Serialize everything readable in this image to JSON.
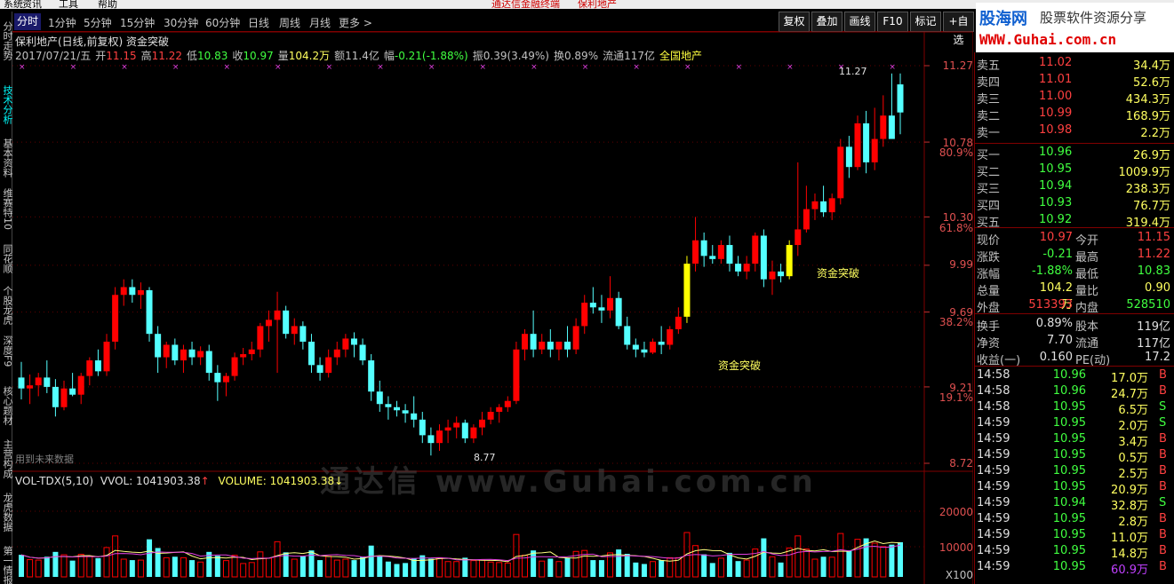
{
  "menu": {
    "items": [
      "系统",
      "资讯",
      "工具",
      "帮助"
    ],
    "title": "通达信金融终端",
    "stock": "保利地产"
  },
  "left_tabs": [
    "分时走势",
    "技术分析",
    "基本资料",
    "维赛特10",
    "同花顺",
    "个股龙虎",
    "深度F9",
    "核心题材",
    "主营构成",
    "龙虎数据",
    "第一情报"
  ],
  "periods": [
    "分时",
    "1分钟",
    "5分钟",
    "15分钟",
    "30分钟",
    "60分钟",
    "日线",
    "周线",
    "月线",
    "更多 >"
  ],
  "toolbar_buttons": [
    "复权",
    "叠加",
    "画线",
    "F10",
    "标记",
    "+自选"
  ],
  "brand": {
    "name": "股海网",
    "slogan": "股票软件资源分享",
    "url": "WWW.Guhai.com.cn"
  },
  "chart_header": "保利地产(日线,前复权) 资金突破",
  "info": {
    "date": "2017/07/21/五",
    "open_label": "开",
    "open": "11.15",
    "high_label": "高",
    "high": "11.22",
    "low_label": "低",
    "low": "10.83",
    "close_label": "收",
    "close": "10.97",
    "vol_label": "量",
    "vol": "104.2万",
    "amt_label": "额",
    "amt": "11.4亿",
    "chg_label": "幅",
    "chg": "-0.21(-1.88%)",
    "amp_label": "振",
    "amp": "0.39(3.49%)",
    "turn_label": "换",
    "turn": "0.89%",
    "float_label": "流通",
    "float": "117亿",
    "sector": "全国地产"
  },
  "price_axis": [
    "11.27",
    "10.78",
    "10.30",
    "9.99",
    "9.69",
    "9.21",
    "8.72"
  ],
  "pct_axis": [
    "80.9%",
    "61.8%",
    "38.2%",
    "19.1%"
  ],
  "vol_axis": [
    "20000",
    "10000",
    "X100"
  ],
  "annotations": {
    "high": "11.27",
    "low": "8.77",
    "signal1": "资金突破",
    "signal2": "资金突破",
    "future": "用到未来数据"
  },
  "vol_indicator": {
    "name": "VOL-TDX(5,10)",
    "vvol": "VVOL: 1041903.38",
    "volume": "VOLUME: 1041903.38"
  },
  "colors": {
    "up": "#ff0000",
    "down": "#54ffff",
    "signal": "#ffff00",
    "accent": "#ff3030"
  },
  "order_book": {
    "sell": [
      {
        "label": "卖五",
        "price": "11.02",
        "vol": "34.4万"
      },
      {
        "label": "卖四",
        "price": "11.01",
        "vol": "52.6万"
      },
      {
        "label": "卖三",
        "price": "11.00",
        "vol": "434.3万"
      },
      {
        "label": "卖二",
        "price": "10.99",
        "vol": "168.9万"
      },
      {
        "label": "卖一",
        "price": "10.98",
        "vol": "2.2万"
      }
    ],
    "buy": [
      {
        "label": "买一",
        "price": "10.96",
        "vol": "26.9万"
      },
      {
        "label": "买二",
        "price": "10.95",
        "vol": "1009.9万"
      },
      {
        "label": "买三",
        "price": "10.94",
        "vol": "238.3万"
      },
      {
        "label": "买四",
        "price": "10.93",
        "vol": "76.7万"
      },
      {
        "label": "买五",
        "price": "10.92",
        "vol": "319.4万"
      }
    ]
  },
  "quote": [
    {
      "l1": "现价",
      "v1": "10.97",
      "l2": "今开",
      "v2": "11.15"
    },
    {
      "l1": "涨跌",
      "v1": "-0.21",
      "l2": "最高",
      "v2": "11.22"
    },
    {
      "l1": "涨幅",
      "v1": "-1.88%",
      "l2": "最低",
      "v2": "10.83"
    },
    {
      "l1": "总量",
      "v1": "104.2万",
      "l2": "量比",
      "v2": "0.90"
    },
    {
      "l1": "外盘",
      "v1": "513393",
      "l2": "内盘",
      "v2": "528510"
    }
  ],
  "stats": [
    {
      "l1": "换手",
      "v1": "0.89%",
      "l2": "股本",
      "v2": "119亿"
    },
    {
      "l1": "净资",
      "v1": "7.70",
      "l2": "流通",
      "v2": "117亿"
    },
    {
      "l1": "收益(一)",
      "v1": "0.160",
      "l2": "PE(动)",
      "v2": "17.2"
    }
  ],
  "ticks": [
    {
      "t": "14:58",
      "p": "10.96",
      "v": "17.0万",
      "s": "B"
    },
    {
      "t": "14:58",
      "p": "10.96",
      "v": "24.7万",
      "s": "B"
    },
    {
      "t": "14:58",
      "p": "10.95",
      "v": "6.5万",
      "s": "S"
    },
    {
      "t": "14:59",
      "p": "10.95",
      "v": "2.0万",
      "s": "S"
    },
    {
      "t": "14:59",
      "p": "10.95",
      "v": "3.4万",
      "s": "B"
    },
    {
      "t": "14:59",
      "p": "10.95",
      "v": "0.5万",
      "s": "B"
    },
    {
      "t": "14:59",
      "p": "10.95",
      "v": "2.5万",
      "s": "B"
    },
    {
      "t": "14:59",
      "p": "10.95",
      "v": "20.9万",
      "s": "B"
    },
    {
      "t": "14:59",
      "p": "10.94",
      "v": "32.8万",
      "s": "S"
    },
    {
      "t": "14:59",
      "p": "10.95",
      "v": "2.8万",
      "s": "B"
    },
    {
      "t": "14:59",
      "p": "10.95",
      "v": "11.0万",
      "s": "B"
    },
    {
      "t": "14:59",
      "p": "10.95",
      "v": "14.8万",
      "s": "B"
    },
    {
      "t": "14:59",
      "p": "10.95",
      "v": "60.9万",
      "s": "B"
    }
  ],
  "chart_data": {
    "type": "candlestick",
    "title": "保利地产(日线,前复权) 资金突破",
    "ylim": [
      8.72,
      11.27
    ],
    "ohlc": [
      [
        9.27,
        9.37,
        9.13,
        9.2
      ],
      [
        9.2,
        9.29,
        9.1,
        9.22
      ],
      [
        9.22,
        9.3,
        9.15,
        9.27
      ],
      [
        9.27,
        9.38,
        9.17,
        9.21
      ],
      [
        9.21,
        9.26,
        9.02,
        9.08
      ],
      [
        9.08,
        9.25,
        9.06,
        9.2
      ],
      [
        9.2,
        9.3,
        9.15,
        9.16
      ],
      [
        9.16,
        9.3,
        9.1,
        9.28
      ],
      [
        9.28,
        9.4,
        9.22,
        9.38
      ],
      [
        9.38,
        9.45,
        9.28,
        9.31
      ],
      [
        9.31,
        9.55,
        9.28,
        9.5
      ],
      [
        9.5,
        9.85,
        9.45,
        9.8
      ],
      [
        9.8,
        9.9,
        9.73,
        9.85
      ],
      [
        9.85,
        9.9,
        9.75,
        9.8
      ],
      [
        9.8,
        9.88,
        9.71,
        9.83
      ],
      [
        9.83,
        9.85,
        9.5,
        9.55
      ],
      [
        9.55,
        9.6,
        9.3,
        9.4
      ],
      [
        9.4,
        9.5,
        9.33,
        9.48
      ],
      [
        9.48,
        9.52,
        9.35,
        9.38
      ],
      [
        9.38,
        9.48,
        9.3,
        9.45
      ],
      [
        9.45,
        9.5,
        9.35,
        9.4
      ],
      [
        9.4,
        9.47,
        9.35,
        9.44
      ],
      [
        9.44,
        9.48,
        9.25,
        9.3
      ],
      [
        9.3,
        9.35,
        9.12,
        9.24
      ],
      [
        9.24,
        9.3,
        9.15,
        9.28
      ],
      [
        9.28,
        9.43,
        9.25,
        9.4
      ],
      [
        9.4,
        9.46,
        9.35,
        9.42
      ],
      [
        9.42,
        9.5,
        9.38,
        9.45
      ],
      [
        9.45,
        9.62,
        9.4,
        9.6
      ],
      [
        9.6,
        9.7,
        9.5,
        9.64
      ],
      [
        9.64,
        9.82,
        9.3,
        9.7
      ],
      [
        9.7,
        9.73,
        9.52,
        9.55
      ],
      [
        9.55,
        9.65,
        9.48,
        9.6
      ],
      [
        9.6,
        9.63,
        9.45,
        9.5
      ],
      [
        9.5,
        9.55,
        9.3,
        9.35
      ],
      [
        9.35,
        9.4,
        9.25,
        9.3
      ],
      [
        9.3,
        9.45,
        9.27,
        9.4
      ],
      [
        9.4,
        9.5,
        9.35,
        9.45
      ],
      [
        9.45,
        9.55,
        9.4,
        9.52
      ],
      [
        9.52,
        9.56,
        9.4,
        9.48
      ],
      [
        9.48,
        9.52,
        9.35,
        9.38
      ],
      [
        9.38,
        9.42,
        9.12,
        9.18
      ],
      [
        9.18,
        9.25,
        9.05,
        9.1
      ],
      [
        9.1,
        9.15,
        9.0,
        9.08
      ],
      [
        9.08,
        9.12,
        9.02,
        9.06
      ],
      [
        9.06,
        9.1,
        8.98,
        9.04
      ],
      [
        9.04,
        9.15,
        8.95,
        9.0
      ],
      [
        9.0,
        9.05,
        8.85,
        8.9
      ],
      [
        8.9,
        8.95,
        8.77,
        8.85
      ],
      [
        8.85,
        8.97,
        8.8,
        8.93
      ],
      [
        8.93,
        9.0,
        8.85,
        8.95
      ],
      [
        8.95,
        9.02,
        8.88,
        8.98
      ],
      [
        8.98,
        9.0,
        8.85,
        8.88
      ],
      [
        8.88,
        8.97,
        8.85,
        8.95
      ],
      [
        8.95,
        9.05,
        8.9,
        9.0
      ],
      [
        9.0,
        9.08,
        8.97,
        9.05
      ],
      [
        9.05,
        9.1,
        8.98,
        9.08
      ],
      [
        9.08,
        9.15,
        9.05,
        9.12
      ],
      [
        9.12,
        9.5,
        9.1,
        9.45
      ],
      [
        9.45,
        9.58,
        9.38,
        9.55
      ],
      [
        9.55,
        9.7,
        9.4,
        9.45
      ],
      [
        9.45,
        9.55,
        9.42,
        9.5
      ],
      [
        9.5,
        9.58,
        9.4,
        9.45
      ],
      [
        9.45,
        9.5,
        9.38,
        9.5
      ],
      [
        9.5,
        9.6,
        9.4,
        9.45
      ],
      [
        9.45,
        9.65,
        9.42,
        9.6
      ],
      [
        9.6,
        9.8,
        9.55,
        9.75
      ],
      [
        9.75,
        9.85,
        9.68,
        9.72
      ],
      [
        9.72,
        9.8,
        9.62,
        9.7
      ],
      [
        9.7,
        9.92,
        9.65,
        9.78
      ],
      [
        9.78,
        9.82,
        9.58,
        9.6
      ],
      [
        9.6,
        9.66,
        9.45,
        9.48
      ],
      [
        9.48,
        9.52,
        9.4,
        9.45
      ],
      [
        9.45,
        9.5,
        9.4,
        9.43
      ],
      [
        9.43,
        9.52,
        9.42,
        9.5
      ],
      [
        9.5,
        9.6,
        9.42,
        9.48
      ],
      [
        9.48,
        9.6,
        9.45,
        9.58
      ],
      [
        9.58,
        9.72,
        9.55,
        9.66
      ],
      [
        9.66,
        10.05,
        9.62,
        10.0
      ],
      [
        10.0,
        10.3,
        9.95,
        10.15
      ],
      [
        10.15,
        10.2,
        9.98,
        10.05
      ],
      [
        10.05,
        10.12,
        10.0,
        10.03
      ],
      [
        10.03,
        10.15,
        10.0,
        10.12
      ],
      [
        10.12,
        10.18,
        9.95,
        10.0
      ],
      [
        10.0,
        10.05,
        9.92,
        9.95
      ],
      [
        9.95,
        10.05,
        9.9,
        10.0
      ],
      [
        10.0,
        10.2,
        9.95,
        10.18
      ],
      [
        10.18,
        10.22,
        9.85,
        9.9
      ],
      [
        9.9,
        10.02,
        9.8,
        9.95
      ],
      [
        9.95,
        10.0,
        9.88,
        9.92
      ],
      [
        9.92,
        10.15,
        9.9,
        10.12
      ],
      [
        10.12,
        10.65,
        10.05,
        10.22
      ],
      [
        10.22,
        10.5,
        10.2,
        10.35
      ],
      [
        10.35,
        10.45,
        10.28,
        10.4
      ],
      [
        10.4,
        10.5,
        10.3,
        10.33
      ],
      [
        10.33,
        10.45,
        10.28,
        10.42
      ],
      [
        10.42,
        10.8,
        10.38,
        10.75
      ],
      [
        10.75,
        10.82,
        10.55,
        10.62
      ],
      [
        10.62,
        10.95,
        10.6,
        10.9
      ],
      [
        10.9,
        10.98,
        10.58,
        10.65
      ],
      [
        10.65,
        11.0,
        10.6,
        10.8
      ],
      [
        10.8,
        11.08,
        10.75,
        10.95
      ],
      [
        10.95,
        11.22,
        10.85,
        10.8
      ],
      [
        11.15,
        11.22,
        10.83,
        10.97
      ]
    ]
  }
}
